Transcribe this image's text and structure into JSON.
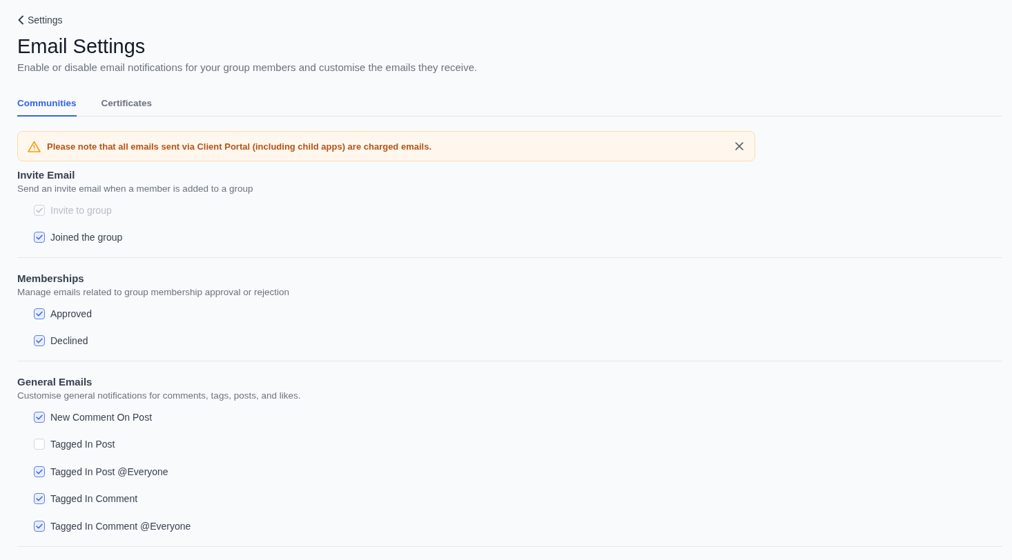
{
  "back_link": {
    "label": "Settings"
  },
  "title": "Email Settings",
  "subtitle": "Enable or disable email notifications for your group members and customise the emails they receive.",
  "tabs": [
    {
      "label": "Communities",
      "selected": true
    },
    {
      "label": "Certificates",
      "selected": false
    }
  ],
  "alert": {
    "message": "Please note that all emails sent via Client Portal (including child apps) are charged emails."
  },
  "sections": [
    {
      "title": "Invite Email",
      "description": "Send an invite email when a member is added to a group",
      "options": [
        {
          "label": "Invite to group",
          "checked": true,
          "disabled": true
        },
        {
          "label": "Joined the group",
          "checked": true,
          "disabled": false
        }
      ]
    },
    {
      "title": "Memberships",
      "description": "Manage emails related to group membership approval or rejection",
      "options": [
        {
          "label": "Approved",
          "checked": true,
          "disabled": false
        },
        {
          "label": "Declined",
          "checked": true,
          "disabled": false
        }
      ]
    },
    {
      "title": "General Emails",
      "description": "Customise general notifications for comments, tags, posts, and likes.",
      "options": [
        {
          "label": "New Comment On Post",
          "checked": true,
          "disabled": false
        },
        {
          "label": "Tagged In Post",
          "checked": false,
          "disabled": false
        },
        {
          "label": "Tagged In Post @Everyone",
          "checked": true,
          "disabled": false
        },
        {
          "label": "Tagged In Comment",
          "checked": true,
          "disabled": false
        },
        {
          "label": "Tagged In Comment @Everyone",
          "checked": true,
          "disabled": false
        }
      ]
    }
  ]
}
